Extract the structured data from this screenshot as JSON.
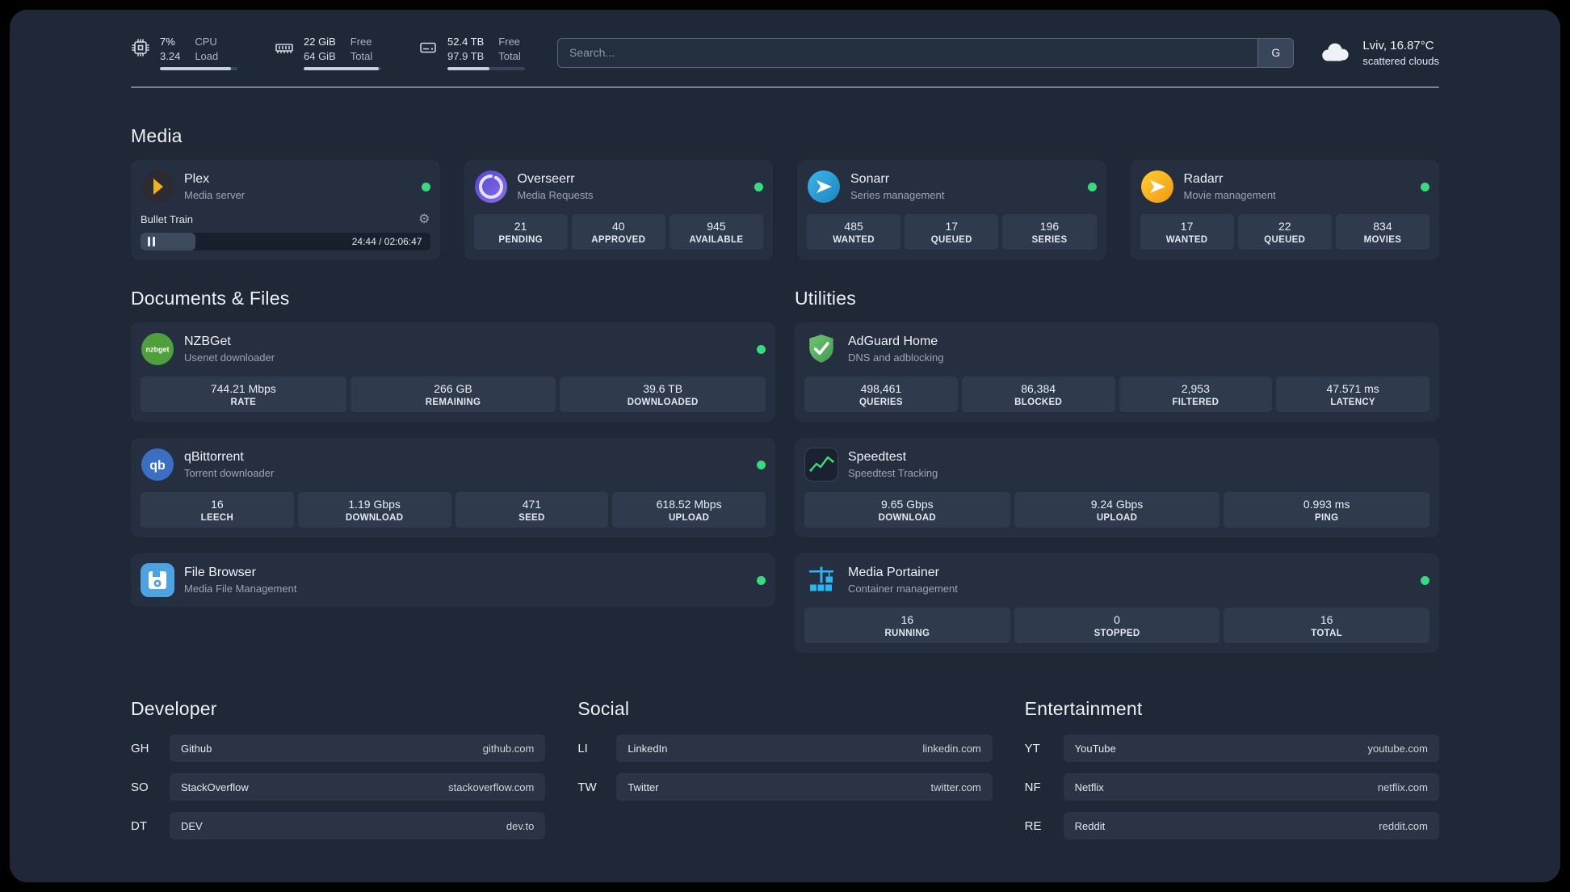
{
  "header": {
    "resources": [
      {
        "icon": "cpu-icon",
        "value_top": "7%",
        "value_bottom": "3.24",
        "label_top": "CPU",
        "label_bottom": "Load",
        "bar_style": "width:92%"
      },
      {
        "icon": "ram-icon",
        "value_top": "22 GiB",
        "value_bottom": "64 GiB",
        "label_top": "Free",
        "label_bottom": "Total",
        "bar_style": "width:97%"
      },
      {
        "icon": "disk-icon",
        "value_top": "52.4 TB",
        "value_bottom": "97.9 TB",
        "label_top": "Free",
        "label_bottom": "Total",
        "bar_style": "width:54%"
      }
    ],
    "search": {
      "placeholder": "Search...",
      "button": "G"
    },
    "weather": {
      "icon": "cloud-icon",
      "location": "Lviv, 16.87°C",
      "condition": "scattered clouds"
    }
  },
  "sections": {
    "media": {
      "title": "Media",
      "cards": [
        {
          "icon": "plex-icon",
          "name": "Plex",
          "subtitle": "Media server",
          "status": "online",
          "player": {
            "track": "Bullet Train",
            "gear_glyph": "⚙",
            "time": "24:44 / 02:06:47",
            "progress_style": "width:19%"
          }
        },
        {
          "icon": "overseerr-icon",
          "name": "Overseerr",
          "subtitle": "Media Requests",
          "status": "online",
          "stats": [
            {
              "value": "21",
              "label": "PENDING"
            },
            {
              "value": "40",
              "label": "APPROVED"
            },
            {
              "value": "945",
              "label": "AVAILABLE"
            }
          ]
        },
        {
          "icon": "sonarr-icon",
          "name": "Sonarr",
          "subtitle": "Series management",
          "status": "online",
          "stats": [
            {
              "value": "485",
              "label": "WANTED"
            },
            {
              "value": "17",
              "label": "QUEUED"
            },
            {
              "value": "196",
              "label": "SERIES"
            }
          ]
        },
        {
          "icon": "radarr-icon",
          "name": "Radarr",
          "subtitle": "Movie management",
          "status": "online",
          "stats": [
            {
              "value": "17",
              "label": "WANTED"
            },
            {
              "value": "22",
              "label": "QUEUED"
            },
            {
              "value": "834",
              "label": "MOVIES"
            }
          ]
        }
      ]
    },
    "documents": {
      "title": "Documents & Files",
      "cards": [
        {
          "icon": "nzbget-icon",
          "icon_text": "nzbget",
          "name": "NZBGet",
          "subtitle": "Usenet downloader",
          "status": "online",
          "stats": [
            {
              "value": "744.21 Mbps",
              "label": "RATE"
            },
            {
              "value": "266 GB",
              "label": "REMAINING"
            },
            {
              "value": "39.6 TB",
              "label": "DOWNLOADED"
            }
          ]
        },
        {
          "icon": "qbittorrent-icon",
          "icon_text": "qb",
          "name": "qBittorrent",
          "subtitle": "Torrent downloader",
          "status": "online",
          "stats": [
            {
              "value": "16",
              "label": "LEECH"
            },
            {
              "value": "1.19 Gbps",
              "label": "DOWNLOAD"
            },
            {
              "value": "471",
              "label": "SEED"
            },
            {
              "value": "618.52 Mbps",
              "label": "UPLOAD"
            }
          ]
        },
        {
          "icon": "filebrowser-icon",
          "name": "File Browser",
          "subtitle": "Media File Management",
          "status": "online"
        }
      ]
    },
    "utilities": {
      "title": "Utilities",
      "cards": [
        {
          "icon": "adguard-icon",
          "name": "AdGuard Home",
          "subtitle": "DNS and adblocking",
          "stats": [
            {
              "value": "498,461",
              "label": "QUERIES"
            },
            {
              "value": "86,384",
              "label": "BLOCKED"
            },
            {
              "value": "2,953",
              "label": "FILTERED"
            },
            {
              "value": "47.571 ms",
              "label": "LATENCY"
            }
          ]
        },
        {
          "icon": "speedtest-icon",
          "name": "Speedtest",
          "subtitle": "Speedtest Tracking",
          "stats": [
            {
              "value": "9.65 Gbps",
              "label": "DOWNLOAD"
            },
            {
              "value": "9.24 Gbps",
              "label": "UPLOAD"
            },
            {
              "value": "0.993 ms",
              "label": "PING"
            }
          ]
        },
        {
          "icon": "portainer-icon",
          "name": "Media Portainer",
          "subtitle": "Container management",
          "status": "online",
          "stats": [
            {
              "value": "16",
              "label": "RUNNING"
            },
            {
              "value": "0",
              "label": "STOPPED"
            },
            {
              "value": "16",
              "label": "TOTAL"
            }
          ]
        }
      ]
    }
  },
  "bookmarks": [
    {
      "title": "Developer",
      "items": [
        {
          "abbr": "GH",
          "name": "Github",
          "url": "github.com"
        },
        {
          "abbr": "SO",
          "name": "StackOverflow",
          "url": "stackoverflow.com"
        },
        {
          "abbr": "DT",
          "name": "DEV",
          "url": "dev.to"
        }
      ]
    },
    {
      "title": "Social",
      "items": [
        {
          "abbr": "LI",
          "name": "LinkedIn",
          "url": "linkedin.com"
        },
        {
          "abbr": "TW",
          "name": "Twitter",
          "url": "twitter.com"
        }
      ]
    },
    {
      "title": "Entertainment",
      "items": [
        {
          "abbr": "YT",
          "name": "YouTube",
          "url": "youtube.com"
        },
        {
          "abbr": "NF",
          "name": "Netflix",
          "url": "netflix.com"
        },
        {
          "abbr": "RE",
          "name": "Reddit",
          "url": "reddit.com"
        }
      ]
    }
  ],
  "colors": {
    "status_online": "#39d97e",
    "panel_bg": "#1e2836",
    "card_bg": "#252f40",
    "plex_accent": "#efb21c"
  }
}
